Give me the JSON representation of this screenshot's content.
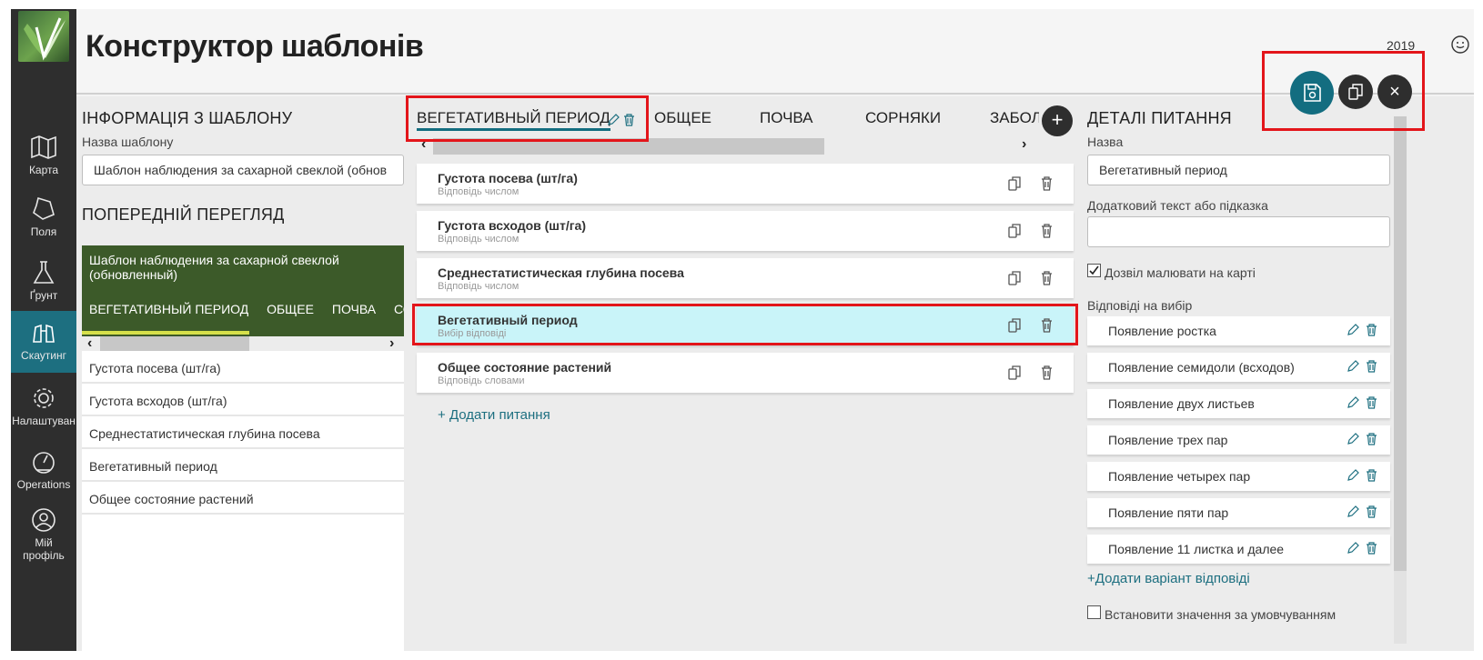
{
  "header": {
    "title": "Конструктор шаблонів",
    "year": "2019"
  },
  "nav": {
    "items": [
      {
        "label": "Карта",
        "icon": "map-icon"
      },
      {
        "label": "Поля",
        "icon": "field-icon"
      },
      {
        "label": "Ґрунт",
        "icon": "flask-icon"
      },
      {
        "label": "Скаутинг",
        "icon": "binoculars-icon",
        "active": true
      },
      {
        "label": "Налаштуван",
        "icon": "gear-icon"
      },
      {
        "label": "Operations",
        "icon": "gauge-icon"
      },
      {
        "label": "Мій",
        "label2": "профіль",
        "icon": "user-icon"
      }
    ]
  },
  "left": {
    "info_title": "ІНФОРМАЦІЯ З ШАБЛОНУ",
    "name_label": "Назва шаблону",
    "name_value": "Шаблон наблюдения за сахарной свеклой (обнов",
    "preview_title": "ПОПЕРЕДНІЙ ПЕРЕГЛЯД",
    "preview_header": "Шаблон наблюдения за сахарной свеклой (обновленный)",
    "preview_tabs": [
      "ВЕГЕТАТИВНЫЙ ПЕРИОД",
      "ОБЩЕЕ",
      "ПОЧВА",
      "СОРН"
    ],
    "preview_rows": [
      "Густота посева (шт/га)",
      "Густота всходов (шт/га)",
      "Среднестатистическая глубина посева",
      "Вегетативный период",
      "Общее состояние растений"
    ]
  },
  "center": {
    "tabs": [
      "ВЕГЕТАТИВНЫЙ ПЕРИОД",
      "ОБЩЕЕ",
      "ПОЧВА",
      "СОРНЯКИ",
      "ЗАБОЛ"
    ],
    "questions": [
      {
        "title": "Густота посева (шт/га)",
        "subtitle": "Відповідь числом"
      },
      {
        "title": "Густота всходов (шт/га)",
        "subtitle": "Відповідь числом"
      },
      {
        "title": "Среднестатистическая глубина посева",
        "subtitle": "Відповідь числом"
      },
      {
        "title": "Вегетативный период",
        "subtitle": "Вибір відповіді"
      },
      {
        "title": "Общее состояние растений",
        "subtitle": "Відповідь словами"
      }
    ],
    "add_question": "Додати питання"
  },
  "right": {
    "title": "ДЕТАЛІ ПИТАННЯ",
    "name_label": "Назва",
    "name_value": "Вегетативный период",
    "hint_label": "Додатковий текст або підказка",
    "hint_value": "",
    "draw_label": "Дозвіл малювати на карті",
    "draw_checked": true,
    "choices_label": "Відповіді на вибір",
    "choices": [
      "Появление ростка",
      "Появление семидоли (всходов)",
      "Появление двух листьев",
      "Появление трех пар",
      "Появление четырех пар",
      "Появление пяти пар",
      "Появление 11 листка и далее"
    ],
    "add_choice": "Додати варіант відповіді",
    "default_label": "Встановити значення за умовчуванням",
    "default_checked": false
  },
  "colors": {
    "nav_bg": "#2e2e2e",
    "accent": "#136d80",
    "preview_green": "#3c5a29",
    "selected_row": "#c9f4f9",
    "highlight_red": "#e3151a"
  }
}
